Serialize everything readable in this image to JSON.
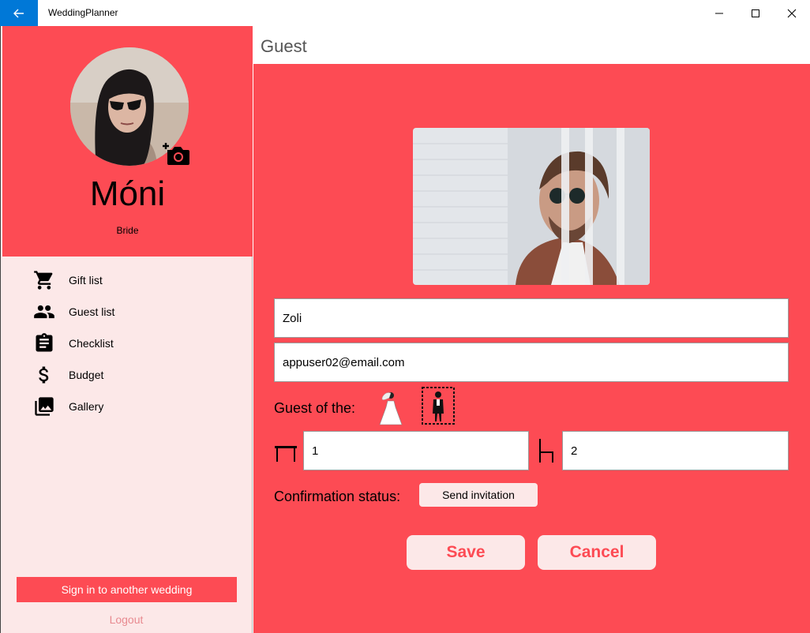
{
  "window": {
    "title": "WeddingPlanner",
    "back_icon": "arrow-left-icon",
    "minimize_icon": "minimize-icon",
    "maximize_icon": "maximize-icon",
    "close_icon": "close-icon",
    "accent": "#0078d7"
  },
  "sidebar": {
    "user": {
      "name": "Móni",
      "role": "Bride"
    },
    "items": [
      {
        "label": "Gift list",
        "icon": "cart-icon"
      },
      {
        "label": "Guest list",
        "icon": "people-icon"
      },
      {
        "label": "Checklist",
        "icon": "clipboard-icon"
      },
      {
        "label": "Budget",
        "icon": "dollar-icon"
      },
      {
        "label": "Gallery",
        "icon": "gallery-icon"
      }
    ],
    "sign_in_label": "Sign in to another wedding",
    "logout_label": "Logout"
  },
  "page": {
    "title": "Guest",
    "name_value": "Zoli",
    "email_value": "appuser02@email.com",
    "guest_of_label": "Guest of the:",
    "table_value": "1",
    "seat_value": "2",
    "confirmation_label": "Confirmation status:",
    "send_invitation_label": "Send invitation",
    "save_label": "Save",
    "cancel_label": "Cancel"
  },
  "colors": {
    "primary": "#fd4b54",
    "sidebar_bg": "#fce8e8",
    "button_bg": "#fce8e8"
  }
}
